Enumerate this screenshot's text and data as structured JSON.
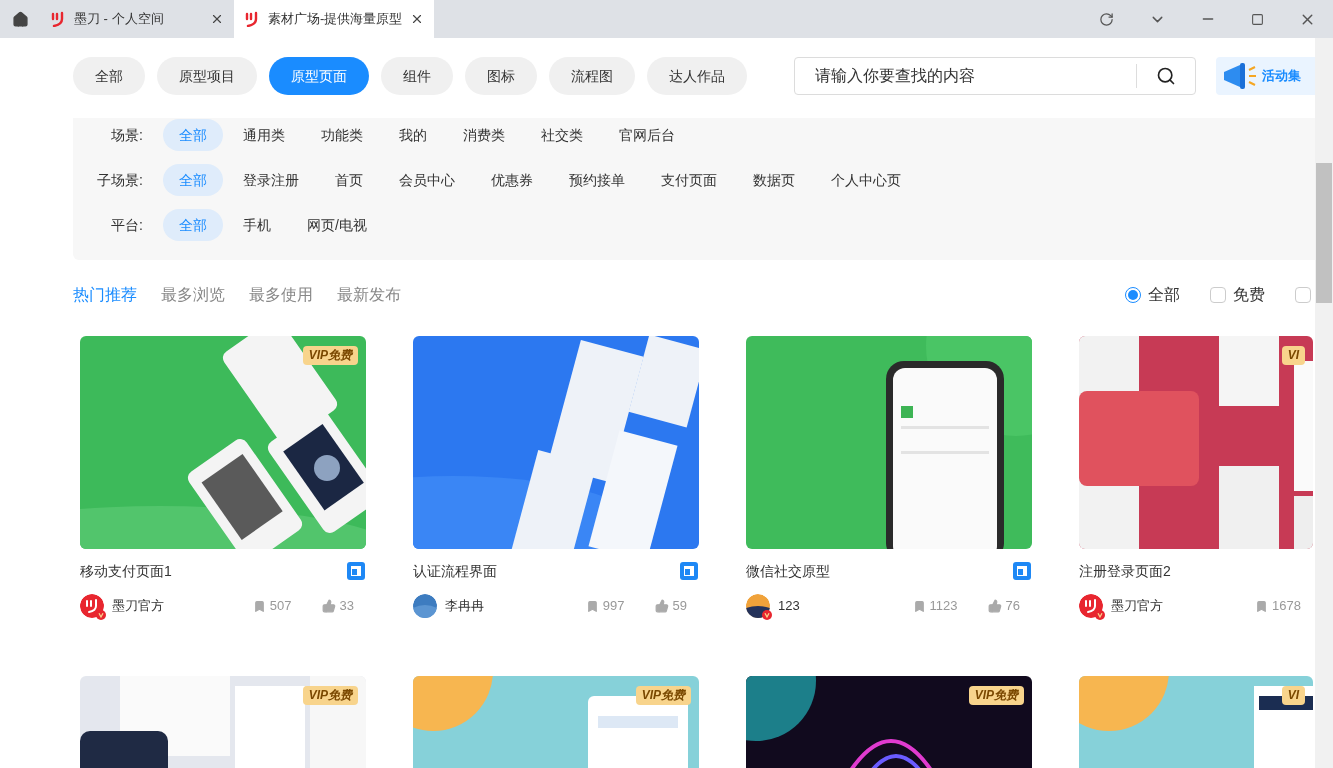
{
  "browser_tabs": [
    {
      "title": "墨刀 - 个人空间",
      "selected": false
    },
    {
      "title": "素材广场-提供海量原型",
      "selected": true
    }
  ],
  "categories": [
    {
      "label": "全部",
      "selected": false
    },
    {
      "label": "原型项目",
      "selected": false
    },
    {
      "label": "原型页面",
      "selected": true
    },
    {
      "label": "组件",
      "selected": false
    },
    {
      "label": "图标",
      "selected": false
    },
    {
      "label": "流程图",
      "selected": false
    },
    {
      "label": "达人作品",
      "selected": false
    }
  ],
  "search": {
    "placeholder": "请输入你要查找的内容"
  },
  "promo": {
    "label": "活动集"
  },
  "filters": [
    {
      "label": "场景:",
      "options": [
        {
          "label": "全部",
          "selected": true
        },
        {
          "label": "通用类",
          "selected": false
        },
        {
          "label": "功能类",
          "selected": false
        },
        {
          "label": "我的",
          "selected": false
        },
        {
          "label": "消费类",
          "selected": false
        },
        {
          "label": "社交类",
          "selected": false
        },
        {
          "label": "官网后台",
          "selected": false
        }
      ]
    },
    {
      "label": "子场景:",
      "options": [
        {
          "label": "全部",
          "selected": true
        },
        {
          "label": "登录注册",
          "selected": false
        },
        {
          "label": "首页",
          "selected": false
        },
        {
          "label": "会员中心",
          "selected": false
        },
        {
          "label": "优惠券",
          "selected": false
        },
        {
          "label": "预约接单",
          "selected": false
        },
        {
          "label": "支付页面",
          "selected": false
        },
        {
          "label": "数据页",
          "selected": false
        },
        {
          "label": "个人中心页",
          "selected": false
        }
      ]
    },
    {
      "label": "平台:",
      "options": [
        {
          "label": "全部",
          "selected": true
        },
        {
          "label": "手机",
          "selected": false
        },
        {
          "label": "网页/电视",
          "selected": false
        }
      ]
    }
  ],
  "sort_tabs": [
    {
      "label": "热门推荐",
      "selected": true
    },
    {
      "label": "最多浏览",
      "selected": false
    },
    {
      "label": "最多使用",
      "selected": false
    },
    {
      "label": "最新发布",
      "selected": false
    }
  ],
  "price_filter": [
    {
      "kind": "radio",
      "label": "全部",
      "selected": true
    },
    {
      "kind": "checkbox",
      "label": "免费",
      "selected": false
    },
    {
      "kind": "checkbox",
      "selected": false
    }
  ],
  "cards": [
    {
      "badge": "VIP免费",
      "title": "移动支付页面1",
      "type_icon": true,
      "author": {
        "name": "墨刀官方",
        "kind": "logo",
        "verified": true
      },
      "bookmarks": "507",
      "likes": "33"
    },
    {
      "title": "认证流程界面",
      "type_icon": true,
      "author": {
        "name": "李冉冉",
        "kind": "sky",
        "verified": false
      },
      "bookmarks": "997",
      "likes": "59"
    },
    {
      "title": "微信社交原型",
      "type_icon": true,
      "author": {
        "name": "123",
        "kind": "sunset",
        "verified": true
      },
      "bookmarks": "1123",
      "likes": "76"
    },
    {
      "badge": "VI",
      "title": "注册登录页面2",
      "type_icon": false,
      "author": {
        "name": "墨刀官方",
        "kind": "logo",
        "verified": true
      },
      "bookmarks": "1678"
    },
    {
      "badge": "VIP免费"
    },
    {
      "badge": "VIP免费"
    },
    {
      "badge": "VIP免费"
    },
    {
      "badge": "VI"
    }
  ]
}
